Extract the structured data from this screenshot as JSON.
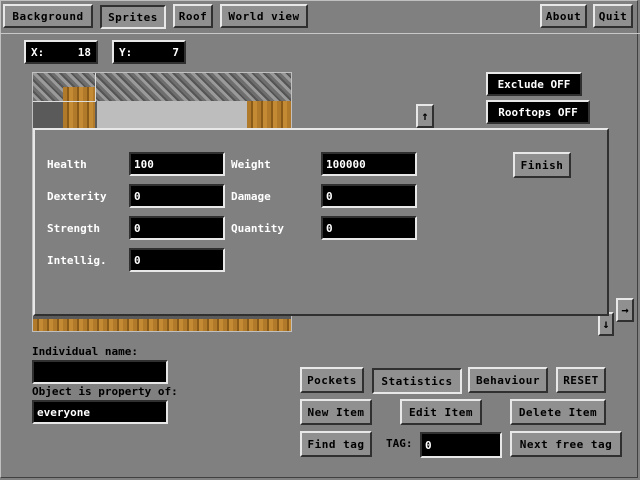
{
  "toolbar": {
    "background": "Background",
    "sprites": "Sprites",
    "roof": "Roof",
    "world_view": "World view",
    "about": "About",
    "quit": "Quit"
  },
  "coords": {
    "x_label": "X:",
    "x_value": "18",
    "y_label": "Y:",
    "y_value": "7"
  },
  "toggles": {
    "exclude": "Exclude OFF",
    "rooftops": "Rooftops OFF"
  },
  "stats": {
    "health_label": "Health",
    "health_value": "100",
    "dexterity_label": "Dexterity",
    "dexterity_value": "0",
    "strength_label": "Strength",
    "strength_value": "0",
    "intellig_label": "Intellig.",
    "intellig_value": "0",
    "weight_label": "Weight",
    "weight_value": "100000",
    "damage_label": "Damage",
    "damage_value": "0",
    "quantity_label": "Quantity",
    "quantity_value": "0",
    "finish": "Finish"
  },
  "object": {
    "individual_name_label": "Individual name:",
    "individual_name_value": "",
    "property_label": "Object is property of:",
    "property_value": "everyone"
  },
  "actions": {
    "pockets": "Pockets",
    "statistics": "Statistics",
    "behaviour": "Behaviour",
    "reset": "RESET",
    "new_item": "New Item",
    "edit_item": "Edit Item",
    "delete_item": "Delete Item",
    "find_tag": "Find tag",
    "tag_label": "TAG:",
    "tag_value": "0",
    "next_free_tag": "Next free tag"
  },
  "arrows": {
    "up": "↑",
    "down": "↓",
    "right": "→"
  }
}
